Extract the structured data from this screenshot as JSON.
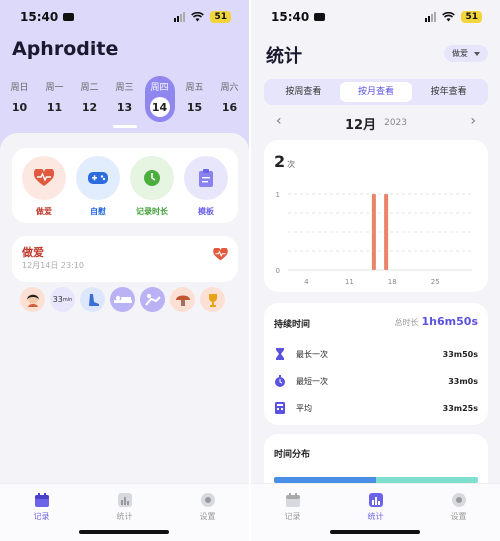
{
  "left": {
    "status": {
      "time": "15:40",
      "battery": "51"
    },
    "app_title": "Aphrodite",
    "week": [
      {
        "name": "周日",
        "date": "10"
      },
      {
        "name": "周一",
        "date": "11"
      },
      {
        "name": "周二",
        "date": "12"
      },
      {
        "name": "周三",
        "date": "13"
      },
      {
        "name": "周四",
        "date": "14",
        "active": true
      },
      {
        "name": "周五",
        "date": "15"
      },
      {
        "name": "周六",
        "date": "16"
      }
    ],
    "quick_actions": [
      {
        "label": "做爱",
        "icon": "heartbeat-icon",
        "color": "#c0392b",
        "bg": "#fde7e1"
      },
      {
        "label": "自慰",
        "icon": "gamepad-icon",
        "color": "#2d6cdf",
        "bg": "#e1ecfd"
      },
      {
        "label": "记录时长",
        "icon": "clock-icon",
        "color": "#3f9c35",
        "bg": "#e5f5e1"
      },
      {
        "label": "模板",
        "icon": "clipboard-icon",
        "color": "#6c63e8",
        "bg": "#e8e6fb"
      }
    ],
    "record": {
      "title": "做爱",
      "time": "12月14日 23:10",
      "tags": [
        {
          "icon": "face-icon",
          "bg": "#fde0d4"
        },
        {
          "text": "33",
          "unit": "min",
          "bg": "#e8e6fb"
        },
        {
          "icon": "foot-icon",
          "bg": "#dce7fb"
        },
        {
          "icon": "bed-icon",
          "bg": "#d7d3f8"
        },
        {
          "icon": "position-icon",
          "bg": "#d7d3f8"
        },
        {
          "icon": "mushroom-icon",
          "bg": "#fde0d4"
        },
        {
          "icon": "trophy-icon",
          "bg": "#fde0d4"
        }
      ]
    },
    "tabs": [
      {
        "label": "记录",
        "icon": "calendar-icon",
        "active": true
      },
      {
        "label": "统计",
        "icon": "bar-chart-icon"
      },
      {
        "label": "设置",
        "icon": "settings-icon"
      }
    ]
  },
  "right": {
    "status": {
      "time": "15:40",
      "battery": "51"
    },
    "title": "统计",
    "filter": "做爱",
    "segments": [
      "按周查看",
      "按月查看",
      "按年查看"
    ],
    "active_segment": 1,
    "month": "12月",
    "year": "2023",
    "count": {
      "value": "2",
      "unit": "次"
    },
    "chart_data": {
      "type": "bar",
      "x": [
        15,
        17
      ],
      "values": [
        1,
        1
      ],
      "x_ticks": [
        "4",
        "11",
        "18",
        "25"
      ],
      "x_tick_values": [
        4,
        11,
        18,
        25
      ],
      "y_ticks": [
        "1",
        "0"
      ],
      "ylim": [
        0,
        1
      ],
      "xlim": [
        1,
        31
      ],
      "color": "#e88468",
      "grid": true
    },
    "duration": {
      "title": "持续时间",
      "total_label": "总时长",
      "total_value": "1h6m50s",
      "rows": [
        {
          "label": "最长一次",
          "value": "33m50s",
          "icon": "hourglass-icon"
        },
        {
          "label": "最短一次",
          "value": "33m0s",
          "icon": "stopwatch-icon"
        },
        {
          "label": "平均",
          "value": "33m25s",
          "icon": "calculator-icon"
        }
      ]
    },
    "distribution": {
      "title": "时间分布",
      "segments": [
        {
          "share": 0.5,
          "color": "#4a8fe7"
        },
        {
          "share": 0.5,
          "color": "#7fe0cf"
        }
      ]
    },
    "tabs": [
      {
        "label": "记录",
        "icon": "calendar-icon"
      },
      {
        "label": "统计",
        "icon": "bar-chart-icon",
        "active": true
      },
      {
        "label": "设置",
        "icon": "settings-icon"
      }
    ]
  }
}
